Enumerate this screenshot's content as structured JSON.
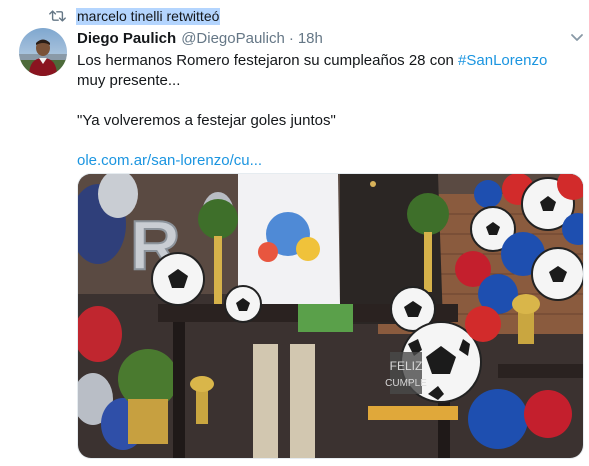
{
  "retweet": {
    "text": "marcelo tinelli retwitteó",
    "icon": "retweet-icon"
  },
  "author": {
    "display_name": "Diego Paulich",
    "handle": "@DiegoPaulich",
    "separator": "·",
    "time": "18h"
  },
  "tweet": {
    "line1_prefix": "Los hermanos Romero festejaron su cumpleaños 28 con ",
    "hashtag": "#SanLorenzo",
    "line2": "muy presente...",
    "quote": "\"Ya volveremos a festejar goles juntos\"",
    "link": "ole.com.ar/san-lorenzo/cu..."
  },
  "media": {
    "description_icon": "party-photo",
    "cake_text_line1": "FELIZ",
    "cake_text_line2": "CUMPLE"
  },
  "colors": {
    "link": "#1b95e0",
    "text": "#14171a",
    "secondary": "#657786",
    "selection": "#b4d5fe"
  }
}
